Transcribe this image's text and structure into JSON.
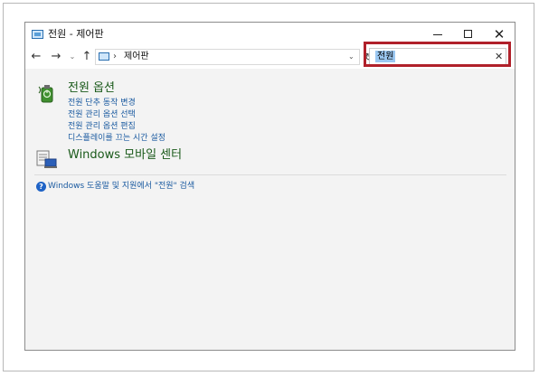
{
  "window": {
    "title": "전원 - 제어판",
    "minimize_icon": "minimize-icon",
    "maximize_icon": "maximize-icon",
    "close_glyph": "✕"
  },
  "nav": {
    "back_glyph": "←",
    "forward_glyph": "→",
    "recent_glyph": "⌄",
    "up_glyph": "↑",
    "refresh_glyph": "↻"
  },
  "address": {
    "separator": "›",
    "location": "제어판",
    "dropdown_glyph": "⌄"
  },
  "search": {
    "value": "전원",
    "clear_glyph": "✕"
  },
  "results": {
    "power_options": {
      "heading": "전원 옵션",
      "links": [
        "전원 단추 동작 변경",
        "전원 관리 옵션 선택",
        "전원 관리 옵션 편집",
        "디스플레이를 끄는 시간 설정"
      ]
    },
    "mobility_center": {
      "heading": "Windows 모바일 센터"
    },
    "help": {
      "glyph": "?",
      "text": "Windows 도움말 및 지원에서 \"전원\" 검색"
    }
  },
  "colors": {
    "heading_green": "#1a5a1a",
    "link_blue": "#1a5aa0",
    "highlight_red": "#b0202a",
    "selection_blue": "#9bc8f2"
  }
}
